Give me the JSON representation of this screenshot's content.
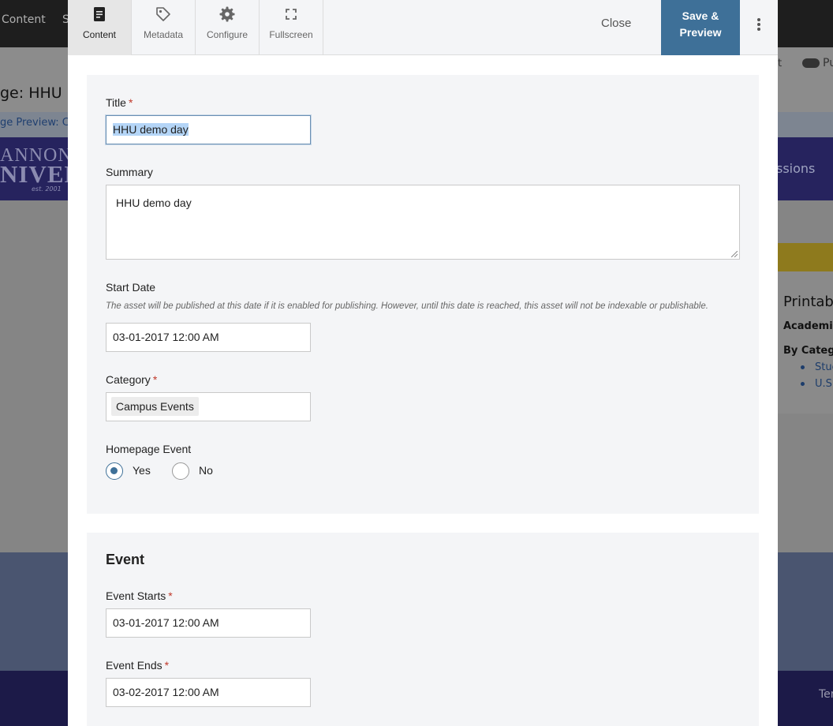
{
  "background": {
    "topbar_items": [
      "Content",
      "S"
    ],
    "page_title": "ge: HHU",
    "actions": [
      "t",
      "Pu"
    ],
    "preview_link": "ge Preview: C",
    "logo_line1": "ANNON",
    "logo_line2": "NIVER",
    "logo_est": "est. 2001",
    "nav_item": "ssions",
    "side_heading": "Printab",
    "side_bold": "Academic",
    "side_by_category": "By Catego",
    "side_links": [
      "Stuc",
      "U.S."
    ],
    "footer_text": "Ter"
  },
  "toolbar": {
    "tabs": [
      {
        "label": "Content",
        "icon": "document-icon"
      },
      {
        "label": "Metadata",
        "icon": "tag-icon"
      },
      {
        "label": "Configure",
        "icon": "gear-icon"
      },
      {
        "label": "Fullscreen",
        "icon": "fullscreen-icon"
      }
    ],
    "close_label": "Close",
    "save_line1": "Save &",
    "save_line2": "Preview",
    "accent_color": "#3e7098"
  },
  "form": {
    "title_label": "Title",
    "title_value": "HHU demo day",
    "summary_label": "Summary",
    "summary_value": "HHU demo day",
    "start_date_label": "Start Date",
    "start_date_help": "The asset will be published at this date if it is enabled for publishing. However, until this date is reached, this asset will not be indexable or publishable.",
    "start_date_value": "03-01-2017 12:00 AM",
    "category_label": "Category",
    "category_value": "Campus Events",
    "homepage_label": "Homepage Event",
    "homepage_options": [
      "Yes",
      "No"
    ],
    "homepage_selected": "Yes",
    "required_marker": "*"
  },
  "event": {
    "section_title": "Event",
    "starts_label": "Event Starts",
    "starts_value": "03-01-2017 12:00 AM",
    "ends_label": "Event Ends",
    "ends_value": "03-02-2017 12:00 AM"
  }
}
